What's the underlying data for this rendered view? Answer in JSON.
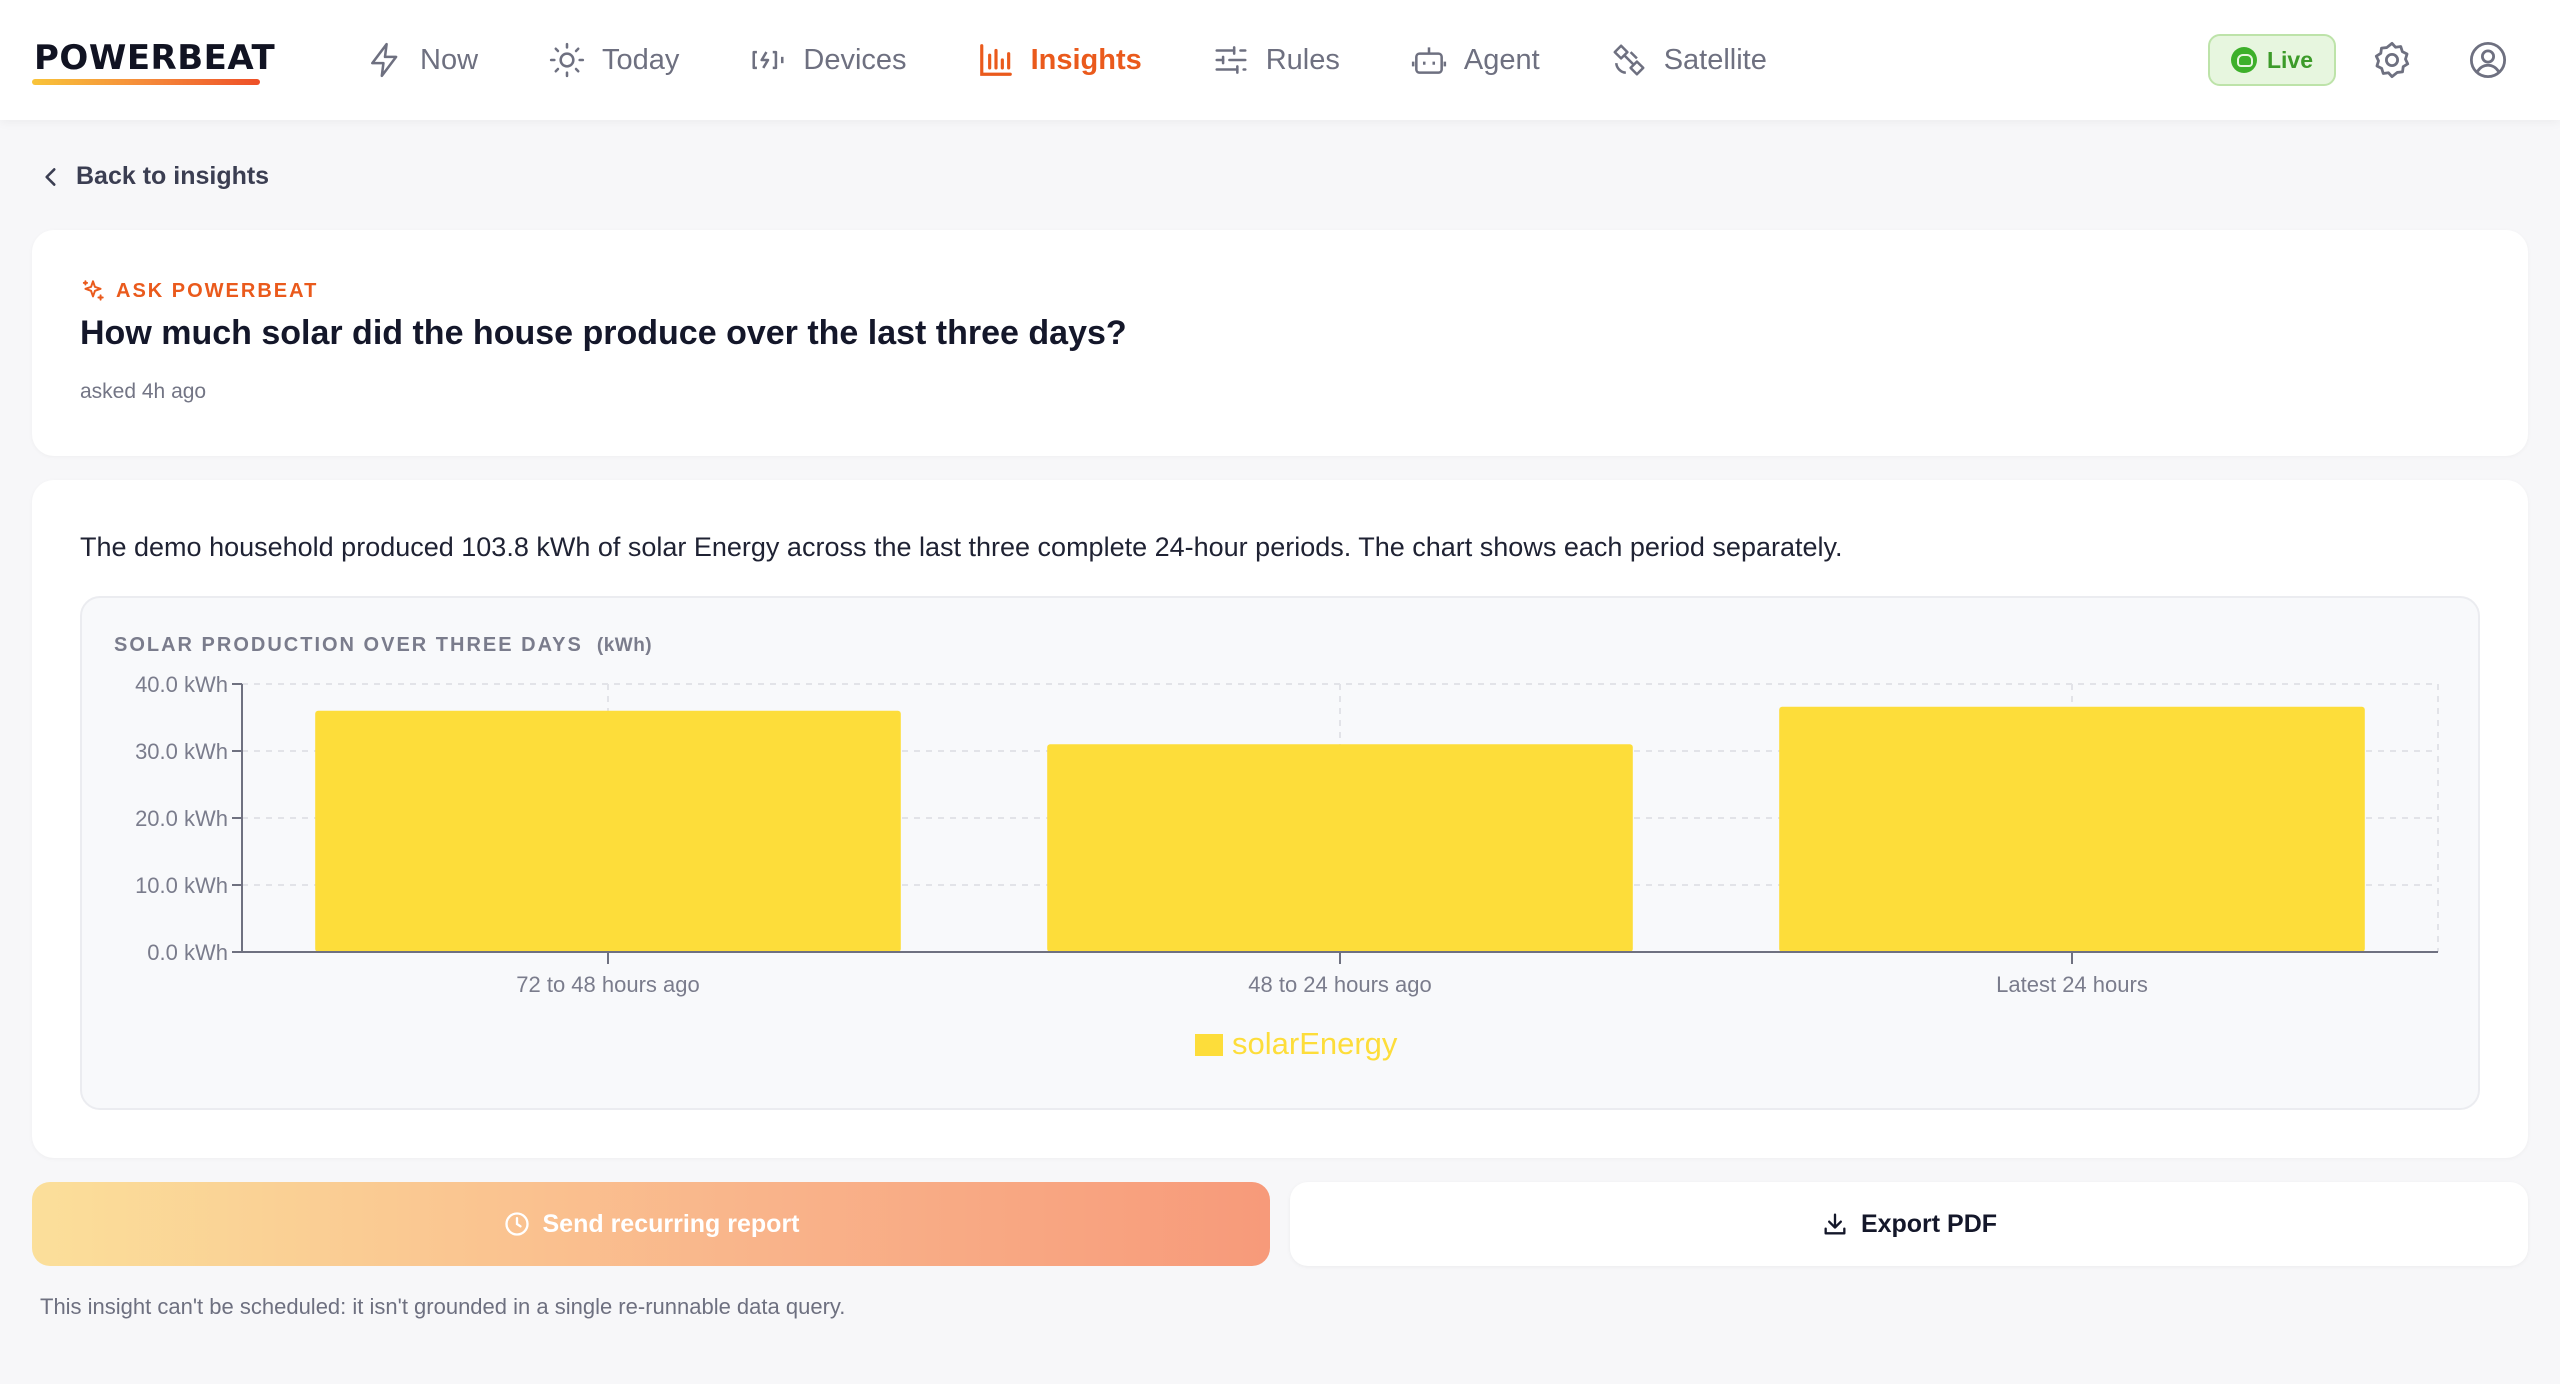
{
  "brand": {
    "name": "POWERBEAT"
  },
  "nav": {
    "items": [
      {
        "label": "Now",
        "icon": "bolt-icon",
        "active": false
      },
      {
        "label": "Today",
        "icon": "sun-icon",
        "active": false
      },
      {
        "label": "Devices",
        "icon": "battery-icon",
        "active": false
      },
      {
        "label": "Insights",
        "icon": "bar-chart-icon",
        "active": true
      },
      {
        "label": "Rules",
        "icon": "sliders-icon",
        "active": false
      },
      {
        "label": "Agent",
        "icon": "robot-icon",
        "active": false
      },
      {
        "label": "Satellite",
        "icon": "satellite-icon",
        "active": false
      }
    ]
  },
  "status": {
    "live_label": "Live"
  },
  "back": {
    "label": "Back to insights"
  },
  "question": {
    "eyebrow": "ASK POWERBEAT",
    "title": "How much solar did the house produce over the last three days?",
    "asked": "asked 4h ago"
  },
  "answer": {
    "text": "The demo household produced 103.8 kWh of solar Energy across the last three complete 24-hour periods. The chart shows each period separately."
  },
  "chart_data": {
    "type": "bar",
    "title": "SOLAR PRODUCTION OVER THREE DAYS",
    "unit": "(kWh)",
    "categories": [
      "72 to 48 hours ago",
      "48 to 24 hours ago",
      "Latest 24 hours"
    ],
    "series": [
      {
        "name": "solarEnergy",
        "values": [
          36.0,
          31.0,
          36.6
        ],
        "color": "#fddd3a"
      }
    ],
    "ylim": [
      0,
      40
    ],
    "yticks": [
      0,
      10,
      20,
      30,
      40
    ],
    "ytick_labels": [
      "0.0 kWh",
      "10.0 kWh",
      "20.0 kWh",
      "30.0 kWh",
      "40.0 kWh"
    ],
    "grid": true,
    "legend": "bottom-center"
  },
  "actions": {
    "send_label": "Send recurring report",
    "export_label": "Export PDF",
    "note": "This insight can't be scheduled: it isn't grounded in a single re-runnable data query."
  },
  "colors": {
    "accent": "#ea5a1c",
    "live_green": "#3c9b29",
    "bar": "#fddd3a"
  }
}
